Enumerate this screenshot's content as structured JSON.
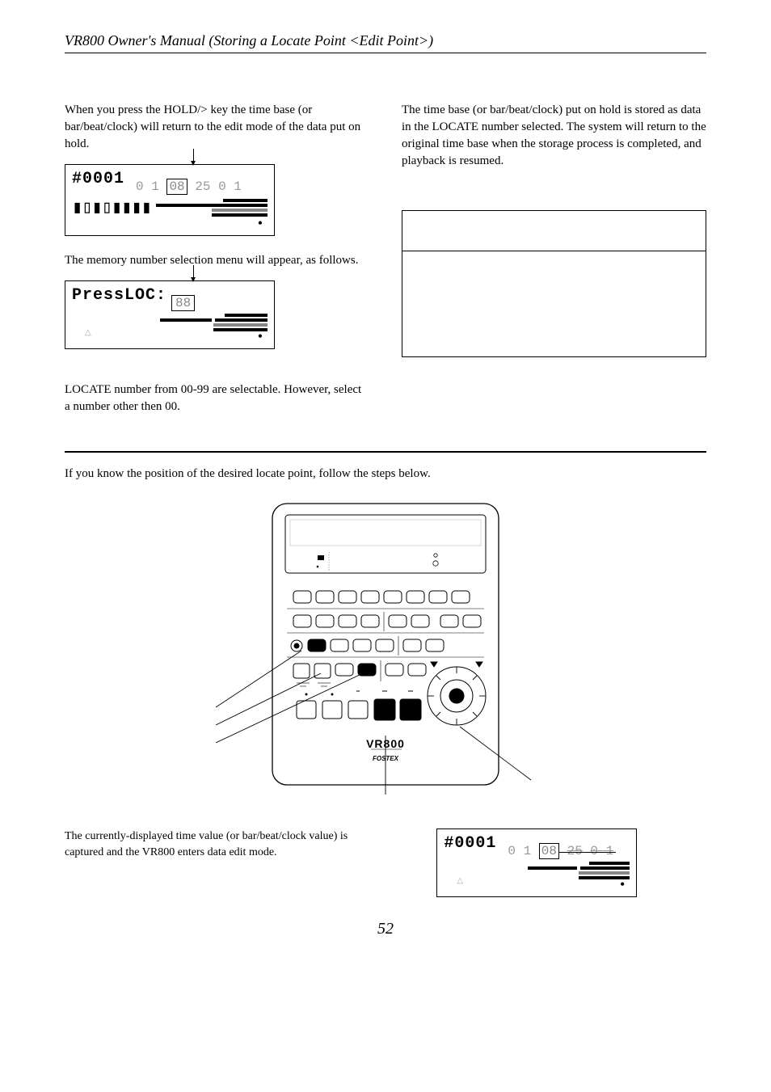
{
  "header": {
    "title": "VR800 Owner's Manual (Storing a Locate Point <Edit Point>)"
  },
  "left": {
    "p1": "When you press the HOLD/> key the time base (or bar/beat/clock) will return to the edit mode of the data put on hold.",
    "lcd1": {
      "big": "#0001",
      "t1": "0 1",
      "t2": "08",
      "t3": "25",
      "t4": "0 1",
      "glyph": "▮▯▮▯▮▮▮▮"
    },
    "p2": "The memory number selection menu will appear, as follows.",
    "lcd2": {
      "big": "PressLOC:",
      "num": "88"
    },
    "p3": "LOCATE number from 00-99 are selectable.  However, select a number other then 00."
  },
  "right": {
    "p1": "The time base (or bar/beat/clock) put on hold is stored as data in the LOCATE number selected.  The system will return to the original time base when the storage process is completed, and playback is resumed."
  },
  "lower": {
    "intro": "If you know the position of the desired locate point, follow the steps below.",
    "device": {
      "brand1": "VR800",
      "brand2": "FOSTEX"
    },
    "bottom_para": "The currently-displayed time value (or bar/beat/clock value) is captured and the VR800 enters data edit mode.",
    "lcd3": {
      "big": "#0001",
      "t1": "0 1",
      "t2": "08",
      "t3": "25",
      "t4": "0 1"
    }
  },
  "pagenum": "52"
}
